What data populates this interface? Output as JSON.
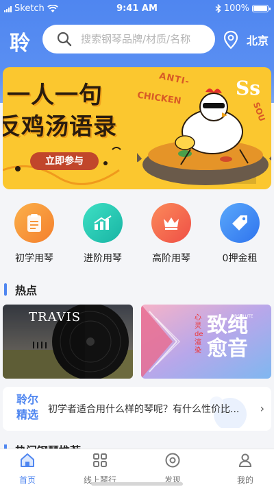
{
  "status": {
    "carrier": "Sketch",
    "time": "9:41 AM",
    "battery": "100%"
  },
  "header": {
    "logo": "聆",
    "search_placeholder": "搜索钢琴品牌/材质/名称",
    "city": "北京",
    "icons": [
      "search-icon",
      "location-pin-icon"
    ]
  },
  "banner": {
    "title_line1": "一人一句",
    "title_line2": "反鸡汤语录",
    "button": "立即参与",
    "tag_anti": "ANTI-",
    "tag_chicken": "CHICKEN",
    "tag_ss": "Ss",
    "tag_sou": "SOU"
  },
  "categories": [
    {
      "label": "初学用琴",
      "icon": "clipboard-icon",
      "color": "#f7953a"
    },
    {
      "label": "进阶用琴",
      "icon": "trend-up-icon",
      "color": "#2dc8b4"
    },
    {
      "label": "高阶用琴",
      "icon": "crown-icon",
      "color": "#f7654f"
    },
    {
      "label": "0押金租",
      "icon": "tag-icon",
      "color": "#3e8cf5"
    }
  ],
  "hot": {
    "title": "热点",
    "card1_text": "TRAVIS",
    "card2_big": "致纯愈音",
    "card2_small": "心灵de渲染",
    "card2_en": "ABSOLUTE MUSIC"
  },
  "featured": {
    "tag_line1": "聆尔",
    "tag_line2": "精选",
    "text": "初学者适合用什么样的琴呢？有什么性价比...",
    "arrow": "›"
  },
  "peek_title": "热门钢琴推荐",
  "tabs": [
    {
      "label": "首页",
      "icon": "home-icon",
      "active": true
    },
    {
      "label": "线上琴行",
      "icon": "grid-icon",
      "active": false
    },
    {
      "label": "发现",
      "icon": "discover-icon",
      "active": false
    },
    {
      "label": "我的",
      "icon": "profile-icon",
      "active": false
    }
  ],
  "colors": {
    "brand": "#4f86f0",
    "banner_bg": "#fbc72f"
  }
}
